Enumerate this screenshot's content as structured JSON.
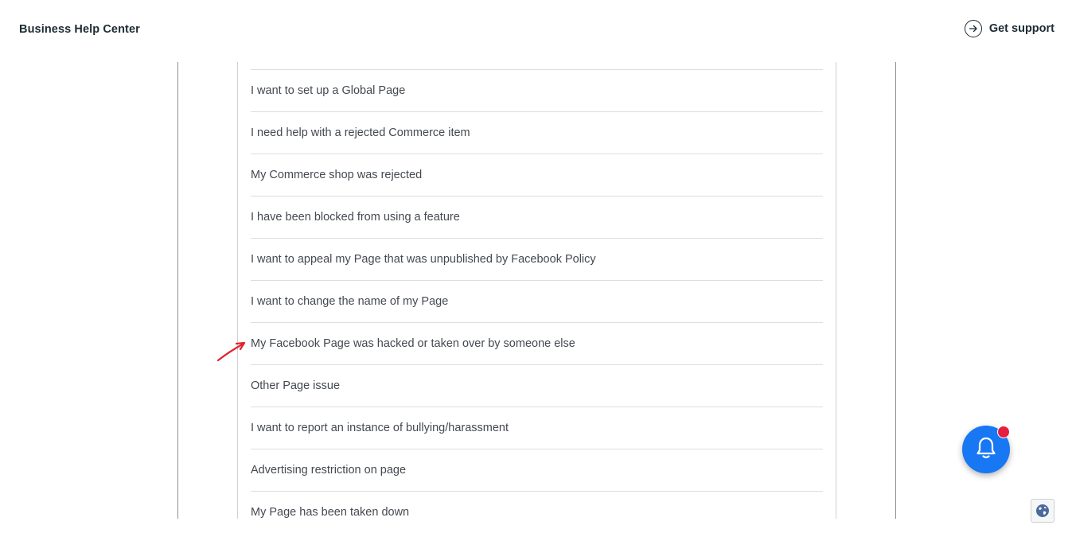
{
  "header": {
    "brand": "Business Help Center",
    "support_label": "Get support"
  },
  "issues": [
    "I want to set up a Global Page",
    "I need help with a rejected Commerce item",
    "My Commerce shop was rejected",
    "I have been blocked from using a feature",
    "I want to appeal my Page that was unpublished by Facebook Policy",
    "I want to change the name of my Page",
    "My Facebook Page was hacked or taken over by someone else",
    "Other Page issue",
    "I want to report an instance of bullying/harassment",
    "Advertising restriction on page",
    "My Page has been taken down"
  ],
  "annotation": {
    "arrow_color": "#e0242f"
  },
  "notifications": {
    "has_unread": true,
    "badge_color": "#e41e3f",
    "button_color": "#1877f2"
  }
}
